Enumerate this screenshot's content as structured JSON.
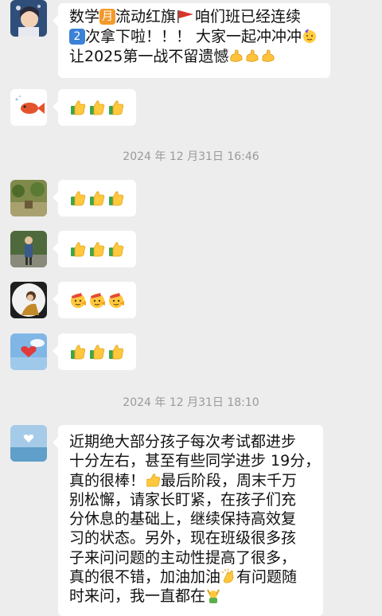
{
  "messages": [
    {
      "avatar": "anime-girl-avatar",
      "lines": [
        [
          "数学",
          "month-badge:月",
          "流动红旗",
          "red-flag-icon",
          "咱们班已经连续"
        ],
        [
          "number-badge:2",
          "次拿下啦！！！ 大家一起冲冲冲",
          "party-face-icon"
        ],
        [
          "让2025第一战不留遗憾",
          "muscle-icon",
          "muscle-icon",
          "muscle-icon"
        ]
      ]
    },
    {
      "avatar": "fish-avatar",
      "emoji": [
        "thumbs-up-icon",
        "thumbs-up-icon",
        "thumbs-up-icon"
      ]
    },
    {
      "timestamp": "2024 年 12 月31日 16:46"
    },
    {
      "avatar": "garden-avatar",
      "emoji": [
        "thumbs-up-icon",
        "thumbs-up-icon",
        "thumbs-up-icon"
      ]
    },
    {
      "avatar": "person-street-avatar",
      "emoji": [
        "thumbs-up-icon",
        "thumbs-up-icon",
        "thumbs-up-icon"
      ]
    },
    {
      "avatar": "woman-profile-avatar",
      "emoji": [
        "salute-face-icon",
        "salute-face-icon",
        "salute-face-icon"
      ]
    },
    {
      "avatar": "heart-sky-avatar",
      "emoji": [
        "thumbs-up-icon",
        "thumbs-up-icon",
        "thumbs-up-icon"
      ]
    },
    {
      "timestamp": "2024 年 12 月31日 18:10"
    },
    {
      "avatar": "heart-sea-avatar",
      "text_lines": [
        "近期绝大部分孩子每次考试都进步",
        "十分左右，甚至有些同学进步 19分，",
        "真的很棒！",
        "最后阶段，周末千万",
        "别松懈，请家长盯紧，在孩子们充",
        "分休息的基础上，继续保持高效复",
        "习的状态。另外，现在班级很多孩",
        "子来问问题的主动性提高了很多，",
        "真的很不错，加油加油",
        "有问题随",
        "时来问，我一直都在"
      ]
    }
  ],
  "text": {
    "m1_a": "数学",
    "m1_month": "月",
    "m1_b": "流动红旗",
    "m1_c": "咱们班已经连续",
    "m1_num": "2",
    "m1_d": "次拿下啦！！！ 大家一起冲冲冲",
    "m1_e": "让2025第一战不留遗憾",
    "ts1": "2024 年 12 月31日 16:46",
    "ts2": "2024 年 12 月31日 18:10",
    "last_1": "近期绝大部分孩子每次考试都进步",
    "last_2": "十分左右，甚至有些同学进步 19分，",
    "last_3a": "真的很棒！",
    "last_3b": "最后阶段，周末千万",
    "last_4": "别松懈，请家长盯紧，在孩子们充",
    "last_5": "分休息的基础上，继续保持高效复",
    "last_6": "习的状态。另外，现在班级很多孩",
    "last_7": "子来问问题的主动性提高了很多，",
    "last_8a": "真的很不错，加油加油",
    "last_8b": "有问题随",
    "last_9": "时来问，我一直都在"
  },
  "colors": {
    "background": "#ededed",
    "bubble": "#ffffff",
    "timestamp": "#9a9a9a",
    "badge_orange": "#f39a2b",
    "badge_blue": "#3b82d6"
  }
}
